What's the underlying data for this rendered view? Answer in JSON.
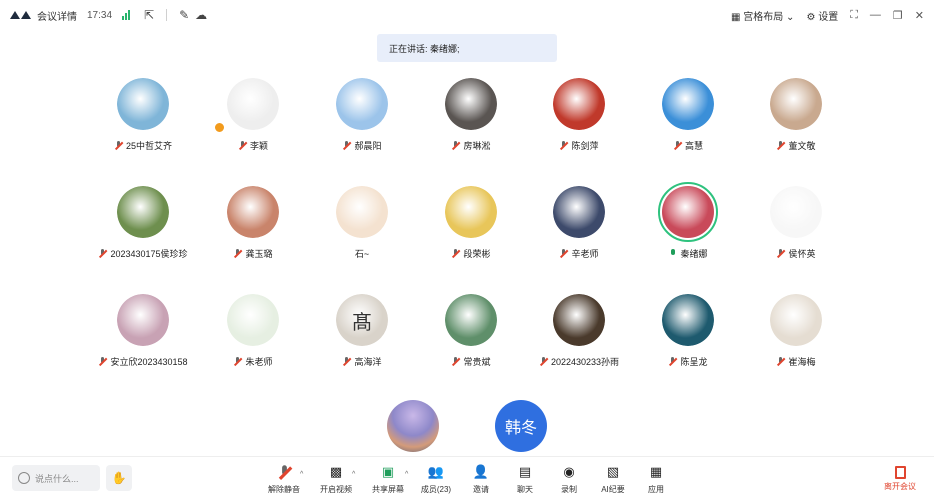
{
  "titlebar": {
    "title": "会议详情",
    "time": "17:34",
    "layout_label": "宫格布局",
    "settings_label": "设置"
  },
  "banner": {
    "speaking_text": "正在讲话: 秦绪娜;"
  },
  "participants": [
    {
      "name": "25中哲艾齐",
      "mic": "muted",
      "color": "#7fb5d8"
    },
    {
      "name": "李颖",
      "mic": "muted",
      "color": "#eeeeee",
      "host": true
    },
    {
      "name": "郝晨阳",
      "mic": "muted",
      "color": "#9cc4ea"
    },
    {
      "name": "房琳淞",
      "mic": "muted",
      "color": "#5a5552"
    },
    {
      "name": "陈剑萍",
      "mic": "muted",
      "color": "#c0392b"
    },
    {
      "name": "高慧",
      "mic": "muted",
      "color": "#3b8fd8"
    },
    {
      "name": "董文敬",
      "mic": "muted",
      "color": "#c9a98f"
    },
    {
      "name": "2023430175侯珍珍",
      "mic": "muted",
      "color": "#6e8f4e"
    },
    {
      "name": "龚玉璐",
      "mic": "muted",
      "color": "#c9846b"
    },
    {
      "name": "石~",
      "mic": "none",
      "color": "#f4e2d0"
    },
    {
      "name": "段荣彬",
      "mic": "muted",
      "color": "#e8c65a"
    },
    {
      "name": "辛老师",
      "mic": "muted",
      "color": "#3d4a6b"
    },
    {
      "name": "秦绪娜",
      "mic": "on",
      "color": "#c94a5a",
      "speaking": true
    },
    {
      "name": "侯怀英",
      "mic": "muted",
      "color": "#f7f7f7"
    },
    {
      "name": "安立欣2023430158",
      "mic": "muted",
      "color": "#c8a2b4"
    },
    {
      "name": "朱老师",
      "mic": "muted",
      "color": "#e6efe2"
    },
    {
      "name": "高海洋",
      "mic": "muted",
      "color": "#d9d3ca"
    },
    {
      "name": "常贵斌",
      "mic": "muted",
      "color": "#5f8f6a"
    },
    {
      "name": "2022430233孙雨",
      "mic": "muted",
      "color": "#4a3a2c"
    },
    {
      "name": "陈呈龙",
      "mic": "muted",
      "color": "#1e5a6e"
    },
    {
      "name": "崔海梅",
      "mic": "muted",
      "color": "#e5ddd2"
    }
  ],
  "gaoyang_glyph": "髙",
  "name_tile": "韩冬",
  "toolbar": {
    "chat_placeholder": "说点什么...",
    "unmute": "解除静音",
    "start_video": "开启视频",
    "share_screen": "共享屏幕",
    "members": "成员(23)",
    "invite": "邀请",
    "chat": "聊天",
    "record": "录制",
    "ai_notes": "AI纪要",
    "apps": "应用",
    "leave": "离开会议"
  },
  "colors": {
    "accent": "#2f6fe0",
    "speaking_ring": "#2ec27e",
    "leave": "#e0452f"
  }
}
